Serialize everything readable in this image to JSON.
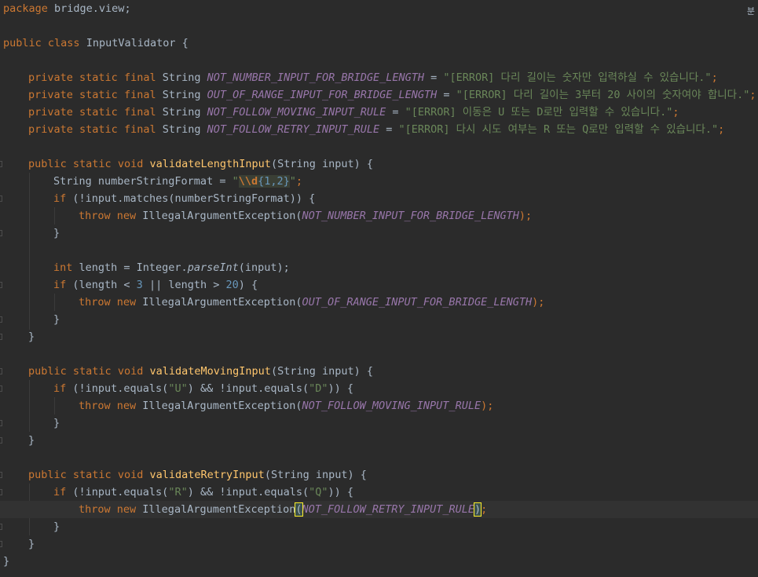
{
  "editor": {
    "corner_label": "분",
    "lines": {
      "l1": {
        "kw": "package",
        "rest": " bridge.view;"
      },
      "l3": {
        "kw1": "public",
        "kw2": "class",
        "name": " InputValidator {"
      },
      "c1": {
        "name": "NOT_NUMBER_INPUT_FOR_BRIDGE_LENGTH",
        "value": "\"[ERROR] 다리 길이는 숫자만 입력하실 수 있습니다.\""
      },
      "c2": {
        "name": "OUT_OF_RANGE_INPUT_FOR_BRIDGE_LENGTH",
        "value": "\"[ERROR] 다리 길이는 3부터 20 사이의 숫자여야 합니다.\""
      },
      "c3": {
        "name": "NOT_FOLLOW_MOVING_INPUT_RULE",
        "value": "\"[ERROR] 이동은 U 또는 D로만 입력할 수 있습니다.\""
      },
      "c4": {
        "name": "NOT_FOLLOW_RETRY_INPUT_RULE",
        "value": "\"[ERROR] 다시 시도 여부는 R 또는 Q로만 입력할 수 있습니다.\""
      },
      "const_prefix": {
        "private": "private",
        "static": "static",
        "final": "final",
        "type": " String "
      },
      "m1": {
        "name": "validateLengthInput",
        "params": "(String input) {"
      },
      "m1_l1": {
        "pre": "String numberStringFormat = ",
        "q1": "\"",
        "esc": "\\\\d",
        "brace": "{1,2}",
        "q2": "\"",
        "end": ";"
      },
      "m1_l2": {
        "pre": "(!input.matches(numberStringFormat)) {"
      },
      "m1_l3": {
        "ex": " IllegalArgumentException(",
        "arg": "NOT_NUMBER_INPUT_FOR_BRIDGE_LENGTH",
        "end": ");"
      },
      "m1_l5": {
        "type": "int",
        "pre": " length = Integer.",
        "call": "parseInt",
        "end": "(input);"
      },
      "m1_l6": {
        "pre": " (length < ",
        "n1": "3",
        "mid": " || length > ",
        "n2": "20",
        "end": ") {"
      },
      "m1_l7": {
        "arg": "OUT_OF_RANGE_INPUT_FOR_BRIDGE_LENGTH",
        "end": ");"
      },
      "m2": {
        "name": "validateMovingInput",
        "params": "(String input) {"
      },
      "m2_l1": {
        "pre": " (!input.equals(",
        "s1": "\"U\"",
        "mid": ") && !input.equals(",
        "s2": "\"D\"",
        "end": ")) {"
      },
      "m2_l2": {
        "arg": "NOT_FOLLOW_MOVING_INPUT_RULE",
        "end": ");"
      },
      "m3": {
        "name": "validateRetryInput",
        "params": "(String input) {"
      },
      "m3_l1": {
        "pre": " (!input.equals(",
        "s1": "\"R\"",
        "mid": ") && !input.equals(",
        "s2": "\"Q\"",
        "end": ")) {"
      },
      "m3_l2": {
        "arg": "NOT_FOLLOW_RETRY_INPUT_RULE",
        "end": ";"
      },
      "kw": {
        "public": "public",
        "static": "static",
        "void": "void",
        "if": "if",
        "throw": "throw",
        "new": "new",
        "ex": " IllegalArgumentException"
      },
      "close1": "}",
      "close2": "}",
      "close0": "}"
    }
  }
}
